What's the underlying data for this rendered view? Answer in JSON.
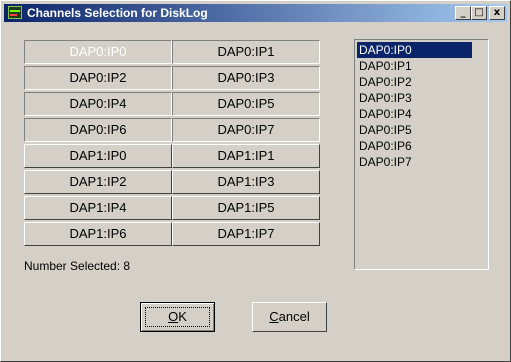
{
  "window": {
    "title": "Channels Selection for DiskLog",
    "controls": {
      "minimize": "_",
      "maximize": "□",
      "close": "x"
    }
  },
  "channels": [
    {
      "label": "DAP0:IP0",
      "pressed": true
    },
    {
      "label": "DAP0:IP1",
      "pressed": true
    },
    {
      "label": "DAP0:IP2",
      "pressed": true
    },
    {
      "label": "DAP0:IP3",
      "pressed": true
    },
    {
      "label": "DAP0:IP4",
      "pressed": true
    },
    {
      "label": "DAP0:IP5",
      "pressed": true
    },
    {
      "label": "DAP0:IP6",
      "pressed": true
    },
    {
      "label": "DAP0:IP7",
      "pressed": true
    },
    {
      "label": "DAP1:IP0",
      "pressed": false
    },
    {
      "label": "DAP1:IP1",
      "pressed": false
    },
    {
      "label": "DAP1:IP2",
      "pressed": false
    },
    {
      "label": "DAP1:IP3",
      "pressed": false
    },
    {
      "label": "DAP1:IP4",
      "pressed": false
    },
    {
      "label": "DAP1:IP5",
      "pressed": false
    },
    {
      "label": "DAP1:IP6",
      "pressed": false
    },
    {
      "label": "DAP1:IP7",
      "pressed": false
    }
  ],
  "selected_count_text": "Number Selected: 8",
  "selected_list": {
    "items": [
      "DAP0:IP0",
      "DAP0:IP1",
      "DAP0:IP2",
      "DAP0:IP3",
      "DAP0:IP4",
      "DAP0:IP5",
      "DAP0:IP6",
      "DAP0:IP7"
    ],
    "highlighted": "DAP0:IP0"
  },
  "buttons": {
    "ok": "OK",
    "cancel": "Cancel"
  },
  "colors": {
    "titlebar_start": "#0a246a",
    "titlebar_end": "#a6caf0",
    "face": "#d4d0c8",
    "selection": "#0a246a"
  }
}
